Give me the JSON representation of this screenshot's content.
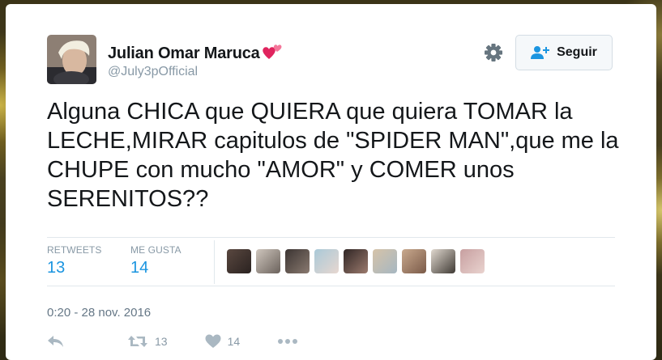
{
  "tweet": {
    "author_name": "Julian Omar Maruca",
    "author_handle": "@July3pOfficial",
    "follow_label": "Seguir",
    "text": "Alguna CHICA que QUIERA que quiera TOMAR la LECHE,MIRAR capitulos de \"SPIDER MAN\",que me la CHUPE con mucho \"AMOR\" y COMER unos SERENITOS??",
    "timestamp": "0:20 - 28 nov. 2016"
  },
  "stats": {
    "retweets_label": "RETWEETS",
    "retweets_count": "13",
    "likes_label": "ME GUSTA",
    "likes_count": "14"
  },
  "actions": {
    "retweet_count": "13",
    "like_count": "14"
  },
  "icons": {
    "author_decoration": "two-hearts-icon",
    "settings": "gear-icon",
    "follow": "add-user-icon",
    "reply": "reply-icon",
    "retweet": "retweet-icon",
    "like": "heart-icon",
    "more": "more-dots-icon"
  },
  "colors": {
    "accent_blue": "#1b95e0",
    "text_dark": "#14171a",
    "text_muted": "#8899a6",
    "heart_pink": "#e0245e"
  }
}
